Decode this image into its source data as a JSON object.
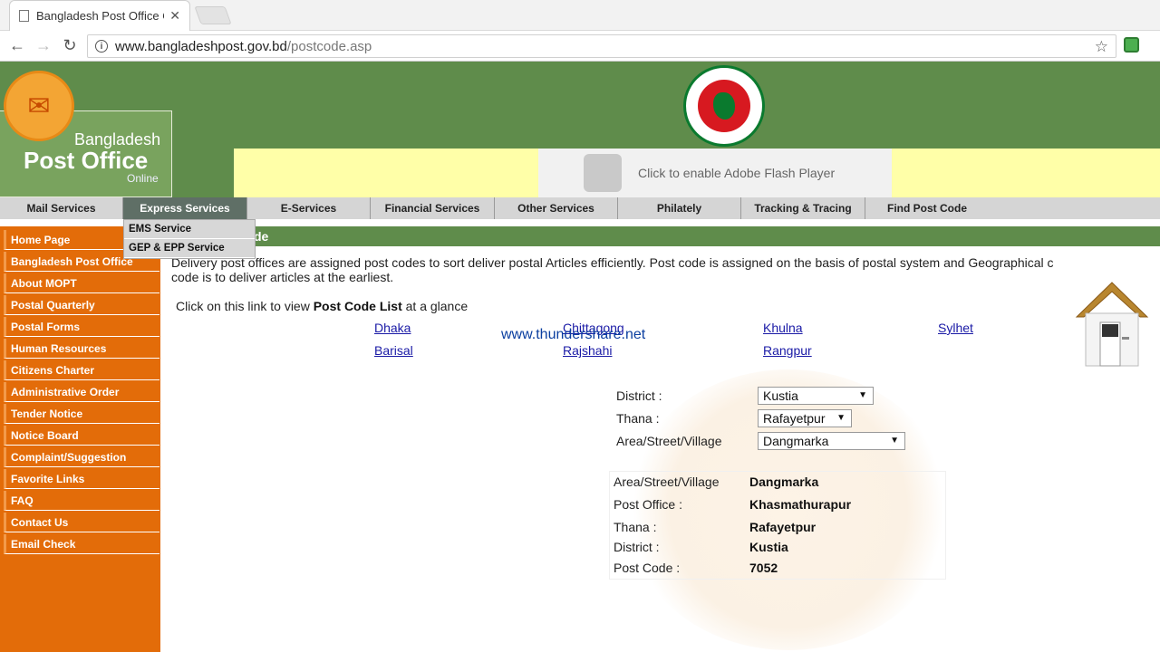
{
  "browser": {
    "tab_title": "Bangladesh Post Office Online",
    "url_host": "www.bangladeshpost.gov.bd",
    "url_path": "/postcode.asp"
  },
  "header": {
    "brand_line1": "Bangladesh",
    "brand_line2": "Post Office",
    "brand_line3": "Online",
    "flash_prompt": "Click to enable Adobe Flash Player"
  },
  "menu": {
    "items": [
      "Mail Services",
      "Express Services",
      "E-Services",
      "Financial Services",
      "Other Services",
      "Philately",
      "Tracking & Tracing",
      "Find Post Code"
    ],
    "active": "Express Services",
    "dropdown": [
      "EMS Service",
      "GEP & EPP Service"
    ]
  },
  "sidebar": {
    "items": [
      "Home Page",
      "Bangladesh Post Office",
      "About MOPT",
      "Postal Quarterly",
      "Postal Forms",
      "Human Resources",
      "Citizens Charter",
      "Administrative Order",
      "Tender Notice",
      "Notice Board",
      "Complaint/Suggestion",
      "Favorite Links",
      "FAQ",
      "Contact Us",
      "Email Check"
    ]
  },
  "content": {
    "section_title": "de",
    "intro_line1": "Delivery post offices are assigned post codes to sort deliver postal Articles efficiently. Post code is assigned on the basis of postal system and Geographical c",
    "intro_line2": "code is to deliver articles at the earliest.",
    "glance_prefix": "Click on this link to view ",
    "glance_bold": "Post Code List",
    "glance_suffix": " at a  glance",
    "divisions": [
      "Dhaka",
      "Chittagong",
      "Khulna",
      "Sylhet",
      "Barisal",
      "Rajshahi",
      "Rangpur"
    ],
    "watermark": "www.thundershare.net"
  },
  "form": {
    "district_label": "District :",
    "district_value": "Kustia",
    "thana_label": "Thana  :",
    "thana_value": "Rafayetpur",
    "area_label": "Area/Street/Village",
    "area_value": "Dangmarka"
  },
  "result": {
    "area_label": "Area/Street/Village",
    "area_value": "Dangmarka",
    "po_label": "Post Office :",
    "po_value": "Khasmathurapur",
    "thana_label": "Thana  :",
    "thana_value": "Rafayetpur",
    "district_label": "District :",
    "district_value": "Kustia",
    "postcode_label": "Post Code :",
    "postcode_value": "7052"
  }
}
